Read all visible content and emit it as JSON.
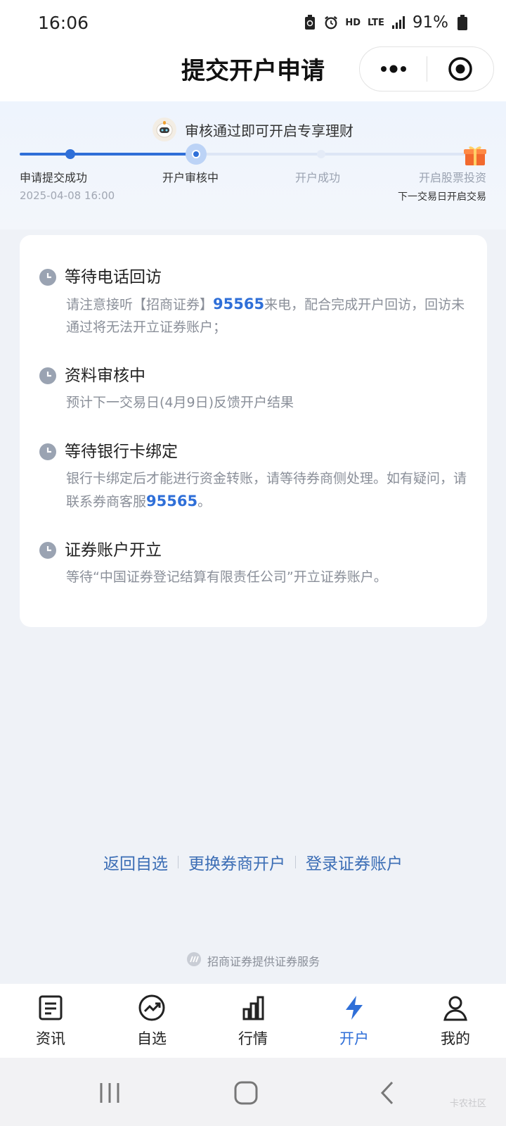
{
  "status_bar": {
    "time": "16:06",
    "network": "HD",
    "lte": "LTE",
    "battery": "91%"
  },
  "header": {
    "title": "提交开户申请"
  },
  "progress": {
    "promo_text": "审核通过即可开启专享理财",
    "steps": [
      {
        "label": "申请提交成功",
        "sub": "2025-04-08 16:00",
        "state": "done"
      },
      {
        "label": "开户审核中",
        "state": "current"
      },
      {
        "label": "开户成功",
        "state": "pending"
      },
      {
        "label": "开启股票投资",
        "sub": "下一交易日开启交易",
        "state": "pending"
      }
    ]
  },
  "items": [
    {
      "title": "等待电话回访",
      "desc_pre": "请注意接听【招商证券】",
      "desc_hl": "95565",
      "desc_post": "来电，配合完成开户回访，回访未通过将无法开立证券账户；"
    },
    {
      "title": "资料审核中",
      "desc_pre": "预计下一交易日(4月9日)反馈开户结果"
    },
    {
      "title": "等待银行卡绑定",
      "desc_pre": "银行卡绑定后才能进行资金转账，请等待券商侧处理。如有疑问，请联系券商客服",
      "desc_hl": "95565",
      "desc_post": "。"
    },
    {
      "title": "证券账户开立",
      "desc_pre": "等待“中国证券登记结算有限责任公司”开立证券账户。"
    }
  ],
  "links": {
    "back": "返回自选",
    "change": "更换券商开户",
    "login": "登录证券账户"
  },
  "provider": "招商证券提供证券服务",
  "tabs": [
    {
      "label": "资讯",
      "icon": "news-icon"
    },
    {
      "label": "自选",
      "icon": "trend-icon"
    },
    {
      "label": "行情",
      "icon": "bar-chart-icon"
    },
    {
      "label": "开户",
      "icon": "lightning-icon",
      "active": true
    },
    {
      "label": "我的",
      "icon": "user-icon"
    }
  ],
  "watermark": "卡农社区",
  "colors": {
    "accent": "#2f6fd8",
    "link": "#3b6db5",
    "muted": "#8a8f99"
  }
}
